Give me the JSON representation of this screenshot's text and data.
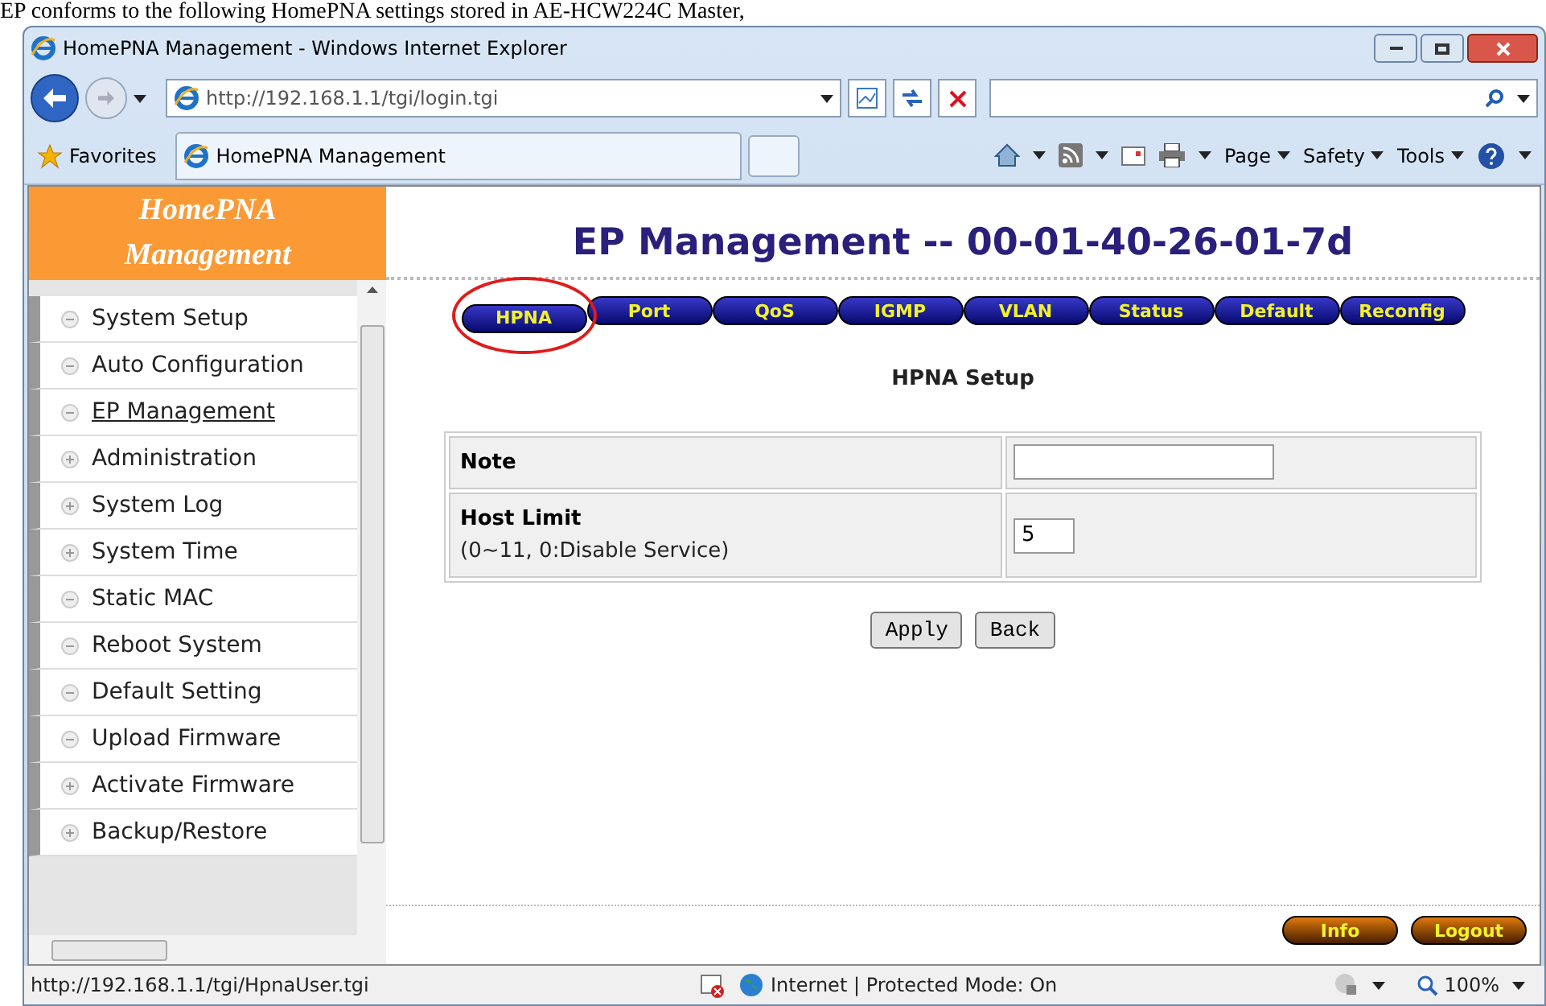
{
  "caption": "EP conforms to the following HomePNA settings stored in AE-HCW224C Master,",
  "window": {
    "title": "HomePNA Management - Windows Internet Explorer"
  },
  "address_bar": {
    "value": "http://192.168.1.1/tgi/login.tgi"
  },
  "favorites_bar": {
    "favorites": "Favorites",
    "tab": "HomePNA Management",
    "menus": [
      "Page",
      "Safety",
      "Tools"
    ]
  },
  "sidebar": {
    "title": "HomePNA Management",
    "items": [
      {
        "label": "System Setup",
        "expanded": true,
        "selected": false
      },
      {
        "label": "Auto Configuration",
        "expanded": true,
        "selected": false
      },
      {
        "label": "EP Management",
        "expanded": true,
        "selected": true
      },
      {
        "label": "Administration",
        "expanded": false,
        "selected": false
      },
      {
        "label": "System Log",
        "expanded": false,
        "selected": false
      },
      {
        "label": "System Time",
        "expanded": false,
        "selected": false
      },
      {
        "label": "Static MAC",
        "expanded": true,
        "selected": false
      },
      {
        "label": "Reboot System",
        "expanded": true,
        "selected": false
      },
      {
        "label": "Default Setting",
        "expanded": true,
        "selected": false
      },
      {
        "label": "Upload Firmware",
        "expanded": true,
        "selected": false
      },
      {
        "label": "Activate Firmware",
        "expanded": false,
        "selected": false
      },
      {
        "label": "Backup/Restore",
        "expanded": false,
        "selected": false
      }
    ]
  },
  "page": {
    "title": "EP Management -- 00-01-40-26-01-7d",
    "tabs": [
      {
        "label": "HPNA",
        "selected": true
      },
      {
        "label": "Port",
        "selected": false
      },
      {
        "label": "QoS",
        "selected": false
      },
      {
        "label": "IGMP",
        "selected": false
      },
      {
        "label": "VLAN",
        "selected": false
      },
      {
        "label": "Status",
        "selected": false
      },
      {
        "label": "Default",
        "selected": false
      },
      {
        "label": "Reconfig",
        "selected": false
      }
    ],
    "section_title": "HPNA Setup",
    "rows": [
      {
        "label": "Note",
        "value": ""
      },
      {
        "label": "Host Limit",
        "hint": "(0~11, 0:Disable Service)",
        "value": "5"
      }
    ],
    "buttons": [
      "Apply",
      "Back"
    ],
    "footer_buttons": [
      "Info",
      "Logout"
    ]
  },
  "status_bar": {
    "url": "http://192.168.1.1/tgi/HpnaUser.tgi",
    "zone": "Internet | Protected Mode: On",
    "zoom": "100%"
  }
}
